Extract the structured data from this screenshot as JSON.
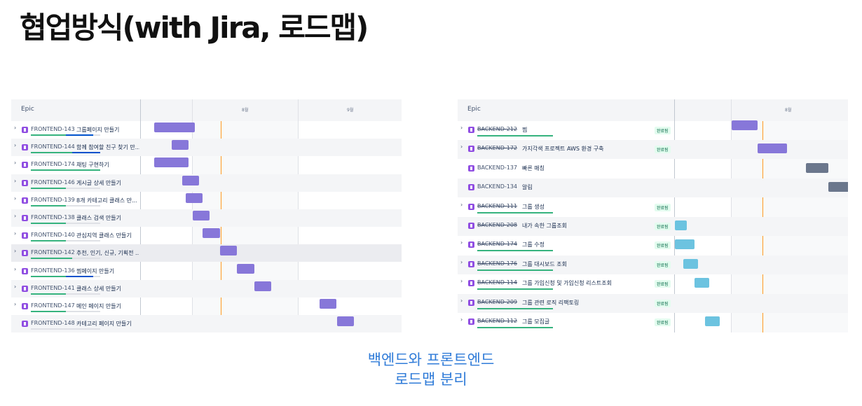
{
  "slide": {
    "title": "협업방식(with Jira, 로드맵)",
    "caption_line1": "백엔드와 프론트엔드",
    "caption_line2": "로드맵 분리"
  },
  "colors": {
    "epic_bar": "#8777d9",
    "done_bar": "#6cc3e0",
    "todo_bar": "#6b778c",
    "today_line": "#ff991f",
    "progress_done": "#36b37e",
    "progress_inprogress": "#0052cc",
    "caption": "#2f7bd8"
  },
  "icons": {
    "expand": "chevron-right-icon",
    "epic": "epic-icon"
  },
  "frontend_roadmap": {
    "column_header": "Epic",
    "months": [
      "8월",
      "9월"
    ],
    "rows": [
      {
        "key": "FRONTEND-143",
        "summary": "그룹페이지 만들기",
        "done": 0.5,
        "inprogress": 0.4,
        "expandable": true
      },
      {
        "key": "FRONTEND-144",
        "summary": "함께 참여할 친구 찾기 만...",
        "done": 0.6,
        "inprogress": 0.4,
        "expandable": true
      },
      {
        "key": "FRONTEND-174",
        "summary": "채팅 구현하기",
        "done": 1,
        "inprogress": 0,
        "expandable": true
      },
      {
        "key": "FRONTEND-146",
        "summary": "게시글 상세 만들기",
        "done": 0.5,
        "inprogress": 0,
        "expandable": true
      },
      {
        "key": "FRONTEND-139",
        "summary": "8개 카테고리 클래스 만...",
        "done": 0.5,
        "inprogress": 0,
        "expandable": true
      },
      {
        "key": "FRONTEND-138",
        "summary": "클래스 검색 만들기",
        "done": 0.5,
        "inprogress": 0,
        "expandable": true
      },
      {
        "key": "FRONTEND-140",
        "summary": "관심지역 클래스 만들기",
        "done": 0.5,
        "inprogress": 0,
        "expandable": true
      },
      {
        "key": "FRONTEND-142",
        "summary": "추천, 인기, 신규, 기획전 ...",
        "done": 0.6,
        "inprogress": 0,
        "expandable": true
      },
      {
        "key": "FRONTEND-136",
        "summary": "찜페이지 만들기",
        "done": 0.5,
        "inprogress": 0.4,
        "expandable": true
      },
      {
        "key": "FRONTEND-141",
        "summary": "클래스 상세 만들기",
        "done": 0.5,
        "inprogress": 0,
        "expandable": true
      },
      {
        "key": "FRONTEND-147",
        "summary": "메인 페이지 만들기",
        "done": 0.5,
        "inprogress": 0,
        "expandable": true
      },
      {
        "key": "FRONTEND-148",
        "summary": "카테고리 페이지 만들기",
        "done": 0,
        "inprogress": 0,
        "expandable": false
      }
    ]
  },
  "backend_roadmap": {
    "column_header": "Epic",
    "months": [
      "8월"
    ],
    "rows": [
      {
        "key": "BACKEND-212",
        "summary": "찜",
        "status": "완료됨",
        "is_done": true,
        "bar": "purple",
        "done": 1,
        "expandable": true
      },
      {
        "key": "BACKEND-172",
        "summary": "가지각색 프로젝트 AWS 환경 구축",
        "status": "완료됨",
        "is_done": true,
        "bar": "purple",
        "done": 0,
        "expandable": true
      },
      {
        "key": "BACKEND-137",
        "summary": "빠른 매칭",
        "status": "",
        "is_done": false,
        "bar": "gray",
        "done": 0,
        "expandable": false
      },
      {
        "key": "BACKEND-134",
        "summary": "알림",
        "status": "",
        "is_done": false,
        "bar": "gray",
        "done": 0,
        "expandable": false
      },
      {
        "key": "BACKEND-111",
        "summary": "그룹 생성",
        "status": "완료됨",
        "is_done": true,
        "bar": "none",
        "done": 1,
        "expandable": true
      },
      {
        "key": "BACKEND-208",
        "summary": "내가 속한 그룹조회",
        "status": "완료됨",
        "is_done": true,
        "bar": "teal",
        "done": 0,
        "expandable": false
      },
      {
        "key": "BACKEND-174",
        "summary": "그룹 수정",
        "status": "완료됨",
        "is_done": true,
        "bar": "teal",
        "done": 1,
        "expandable": true
      },
      {
        "key": "BACKEND-176",
        "summary": "그룹 대시보드 조회",
        "status": "완료됨",
        "is_done": true,
        "bar": "teal",
        "done": 1,
        "expandable": true
      },
      {
        "key": "BACKEND-114",
        "summary": "그룹 가입신청 및 가입신청 리스트조회",
        "status": "완료됨",
        "is_done": true,
        "bar": "teal",
        "done": 1,
        "expandable": true
      },
      {
        "key": "BACKEND-209",
        "summary": "그룹 관련 로직 리팩토링",
        "status": "완료됨",
        "is_done": true,
        "bar": "none",
        "done": 1,
        "expandable": true
      },
      {
        "key": "BACKEND-112",
        "summary": "그룹 모집글",
        "status": "완료됨",
        "is_done": true,
        "bar": "teal",
        "done": 1,
        "expandable": true
      }
    ]
  }
}
